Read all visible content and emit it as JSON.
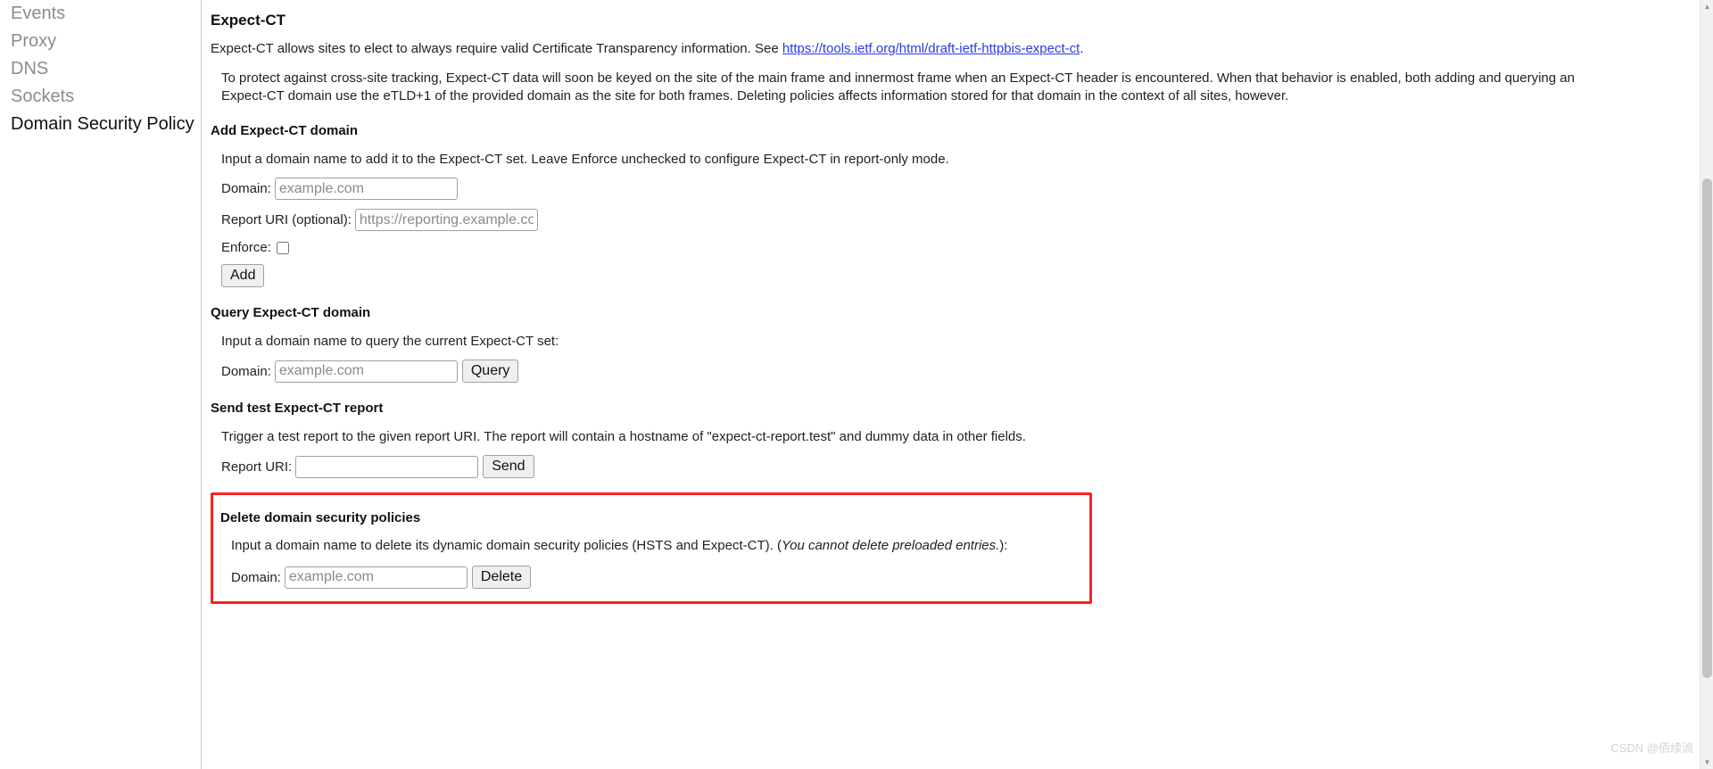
{
  "sidebar": {
    "items": [
      {
        "label": "Events",
        "active": false
      },
      {
        "label": "Proxy",
        "active": false
      },
      {
        "label": "DNS",
        "active": false
      },
      {
        "label": "Sockets",
        "active": false
      },
      {
        "label": "Domain Security Policy",
        "active": true
      }
    ]
  },
  "main": {
    "title": "Expect-CT",
    "intro_before_link": "Expect-CT allows sites to elect to always require valid Certificate Transparency information. See ",
    "intro_link_text": "https://tools.ietf.org/html/draft-ietf-httpbis-expect-ct",
    "intro_link_href": "https://tools.ietf.org/html/draft-ietf-httpbis-expect-ct",
    "intro_after_link": ".",
    "note_paragraph": "To protect against cross-site tracking, Expect-CT data will soon be keyed on the site of the main frame and innermost frame when an Expect-CT header is encountered. When that behavior is enabled, both adding and querying an Expect-CT domain use the eTLD+1 of the provided domain as the site for both frames. Deleting policies affects information stored for that domain in the context of all sites, however."
  },
  "add_section": {
    "heading": "Add Expect-CT domain",
    "description": "Input a domain name to add it to the Expect-CT set. Leave Enforce unchecked to configure Expect-CT in report-only mode.",
    "domain_label": "Domain:",
    "domain_value": "",
    "domain_placeholder": "example.com",
    "report_uri_label": "Report URI (optional):",
    "report_uri_value": "",
    "report_uri_placeholder": "https://reporting.example.com",
    "enforce_label": "Enforce:",
    "enforce_checked": false,
    "add_button": "Add"
  },
  "query_section": {
    "heading": "Query Expect-CT domain",
    "description": "Input a domain name to query the current Expect-CT set:",
    "domain_label": "Domain:",
    "domain_value": "",
    "domain_placeholder": "example.com",
    "query_button": "Query"
  },
  "send_section": {
    "heading": "Send test Expect-CT report",
    "description": "Trigger a test report to the given report URI. The report will contain a hostname of \"expect-ct-report.test\" and dummy data in other fields.",
    "report_uri_label": "Report URI:",
    "report_uri_value": "",
    "report_uri_placeholder": "",
    "send_button": "Send"
  },
  "delete_section": {
    "heading": "Delete domain security policies",
    "description_plain": "Input a domain name to delete its dynamic domain security policies (HSTS and Expect-CT). (",
    "description_italic": "You cannot delete preloaded entries.",
    "description_tail": "):",
    "domain_label": "Domain:",
    "domain_value": "",
    "domain_placeholder": "example.com",
    "delete_button": "Delete",
    "highlight_color": "#ff1f1f"
  },
  "scrollbar": {
    "up_arrow": "▲",
    "down_arrow": "▼"
  },
  "watermark": {
    "text": "CSDN @佰续流"
  }
}
